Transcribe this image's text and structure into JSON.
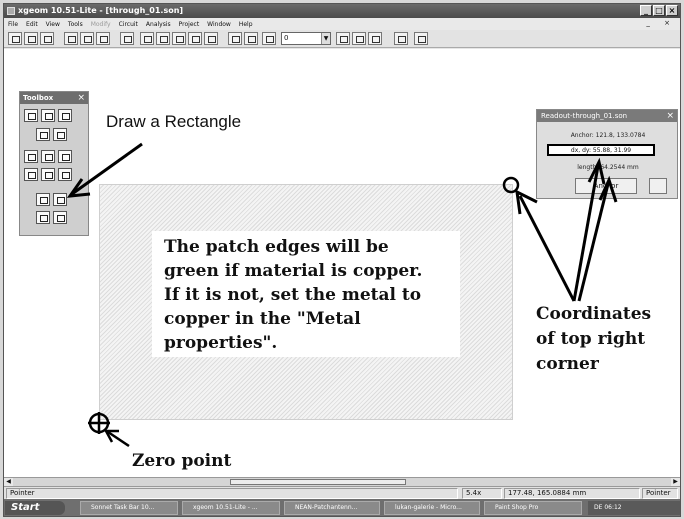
{
  "window": {
    "title": "xgeom 10.51-Lite - [through_01.son]",
    "controls": [
      "_",
      "□",
      "×"
    ]
  },
  "menubar": {
    "items": [
      "File",
      "Edit",
      "View",
      "Tools",
      "Modify",
      "Circuit",
      "Analysis",
      "Project",
      "Window",
      "Help"
    ],
    "disabled": [
      "Modify"
    ],
    "mdi_controls": "_ ×"
  },
  "toolbar": {
    "level_value": "0"
  },
  "toolbox": {
    "title": "Toolbox",
    "close": "×"
  },
  "annotations": {
    "draw_rectangle": "Draw a Rectangle",
    "patch_note": "The patch edges will be\ngreen if material is copper.\nIf it is not, set the metal to\ncopper in the \"Metal\nproperties\".",
    "coordinates": "Coordinates\nof top right\ncorner",
    "zero_point": "Zero point"
  },
  "readout": {
    "title": "Readout-through_01.son",
    "close": "×",
    "anchor": "Anchor: 121.8, 133.0784",
    "dxdy": "dx, dy: 55.88, 31.99",
    "length": "length: 64.2544 mm",
    "anchor_button": "Anchor"
  },
  "statusbar": {
    "mode": "Pointer",
    "zoom": "5.4x",
    "coords": "177.48, 165.0884 mm",
    "right_mode": "Pointer"
  },
  "taskbar": {
    "start": "Start",
    "tasks": [
      "Sonnet Task Bar 10...",
      "xgeom 10.51-Lite - ...",
      "NEAN-Patchantenn...",
      "lukan-galerie - Micro...",
      "Paint Shop Pro"
    ],
    "tray": "DE   06:12"
  },
  "colors": {
    "accent_titlebar": "#4a4a4a",
    "patch_hatch": "#dcdcdc"
  }
}
